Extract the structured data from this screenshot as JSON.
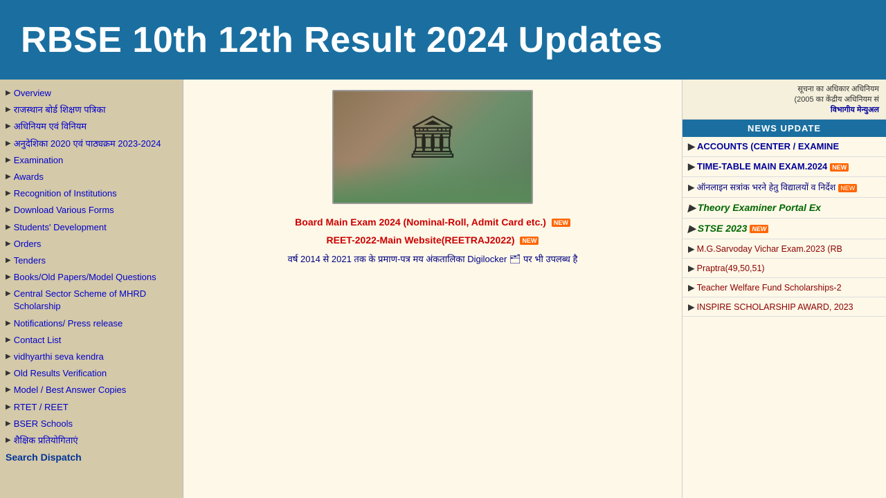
{
  "header": {
    "title": "RBSE 10th 12th Result 2024 Updates"
  },
  "sidebar": {
    "items": [
      {
        "label": "Overview",
        "arrow": "▶",
        "bold": false
      },
      {
        "label": "राजस्थान बोर्ड शिक्षण पत्रिका",
        "arrow": "▶",
        "bold": false
      },
      {
        "label": "अधिनियम एवं विनियम",
        "arrow": "▶",
        "bold": false
      },
      {
        "label": "अनुदेशिका 2020 एवं पाठ्यक्रम 2023-2024",
        "arrow": "▶",
        "bold": false
      },
      {
        "label": "Examination",
        "arrow": "▶",
        "bold": false
      },
      {
        "label": "Awards",
        "arrow": "▶",
        "bold": false
      },
      {
        "label": "Recognition of Institutions",
        "arrow": "▶",
        "bold": false
      },
      {
        "label": "Download Various Forms",
        "arrow": "▶",
        "bold": false
      },
      {
        "label": "Students' Development",
        "arrow": "▶",
        "bold": false
      },
      {
        "label": "Orders",
        "arrow": "▶",
        "bold": false
      },
      {
        "label": "Tenders",
        "arrow": "▶",
        "bold": false
      },
      {
        "label": "Books/Old Papers/Model Questions",
        "arrow": "▶",
        "bold": false
      },
      {
        "label": "Central Sector Scheme of MHRD Scholarship",
        "arrow": "▶",
        "bold": false
      },
      {
        "label": "Notifications/ Press release",
        "arrow": "▶",
        "bold": false
      },
      {
        "label": "Contact List",
        "arrow": "▶",
        "bold": false
      },
      {
        "label": "vidhyarthi seva kendra",
        "arrow": "▶",
        "bold": false
      },
      {
        "label": "Old Results Verification",
        "arrow": "▶",
        "bold": false
      },
      {
        "label": "Model / Best Answer Copies",
        "arrow": "▶",
        "bold": false
      },
      {
        "label": "RTET / REET",
        "arrow": "▶",
        "bold": false
      },
      {
        "label": "BSER Schools",
        "arrow": "▶",
        "bold": false
      },
      {
        "label": "शैक्षिक प्रतियोगिताएं",
        "arrow": "▶",
        "bold": false
      },
      {
        "label": "Search Dispatch",
        "arrow": "",
        "bold": true
      }
    ]
  },
  "main": {
    "link1": "Board Main Exam 2024 (Nominal-Roll, Admit Card etc.)",
    "link2": "REET-2022-Main Website(REETRAJ2022)",
    "text1": "वर्ष 2014 से 2021 तक के प्रमाण-पत्र मय अंकतालिका Digilocker 🗂 पर भी उपलब्ध है",
    "new_label": "NEW"
  },
  "right_panel": {
    "top_text1": "सूचना का अधिकार अधिनियम",
    "top_text2": "(2005 का केंद्रीय अधिनियम सं",
    "top_link": "विभागीय मेन्युअल",
    "news_header": "NEWS UPDATE",
    "news_items": [
      {
        "text": "ACCOUNTS (CENTER / EXAMINE",
        "type": "blue-bold",
        "arrow": "▶"
      },
      {
        "text": "TIME-TABLE MAIN EXAM.2024",
        "type": "blue-bold",
        "arrow": "▶",
        "new": true
      },
      {
        "text": "ऑनलाइन सत्रांक भरने हेतु विद्यालयों व निर्देश",
        "type": "normal",
        "arrow": "▶",
        "new": true
      },
      {
        "text": "Theory Examiner Portal Ex",
        "type": "theory",
        "arrow": "▶"
      },
      {
        "text": "STSE 2023",
        "type": "theory",
        "arrow": "▶",
        "new": true
      },
      {
        "text": "M.G.Sarvoday Vichar Exam.2023 (RB",
        "type": "dark-red",
        "arrow": "▶"
      },
      {
        "text": "Praptra(49,50,51)",
        "type": "dark-red",
        "arrow": "▶"
      },
      {
        "text": "Teacher Welfare Fund Scholarships-2",
        "type": "dark-red",
        "arrow": "▶"
      },
      {
        "text": "INSPIRE SCHOLARSHIP AWARD, 2023",
        "type": "dark-red",
        "arrow": "▶"
      }
    ]
  }
}
